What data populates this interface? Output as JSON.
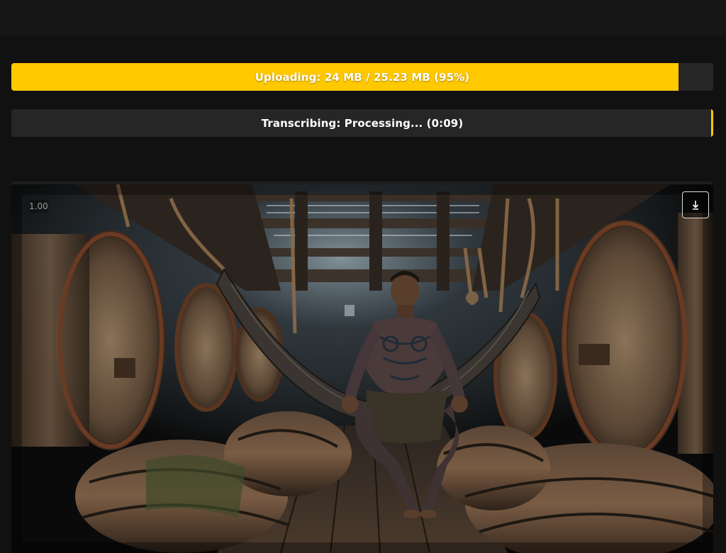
{
  "upload": {
    "label": "Uploading: 24 MB / 25.23 MB (95%)",
    "fraction": 0.95,
    "fill_color": "#ffc900"
  },
  "transcribe": {
    "label": "Transcribing: Processing... (0:09)",
    "fill_color": "#ffc900"
  },
  "image": {
    "zoom_label": "1.00",
    "download_icon": "download-icon",
    "description_alt": "ship-hold-hammock-image"
  },
  "colors": {
    "background": "#111111",
    "track": "#262626",
    "accent": "#ffc900"
  }
}
